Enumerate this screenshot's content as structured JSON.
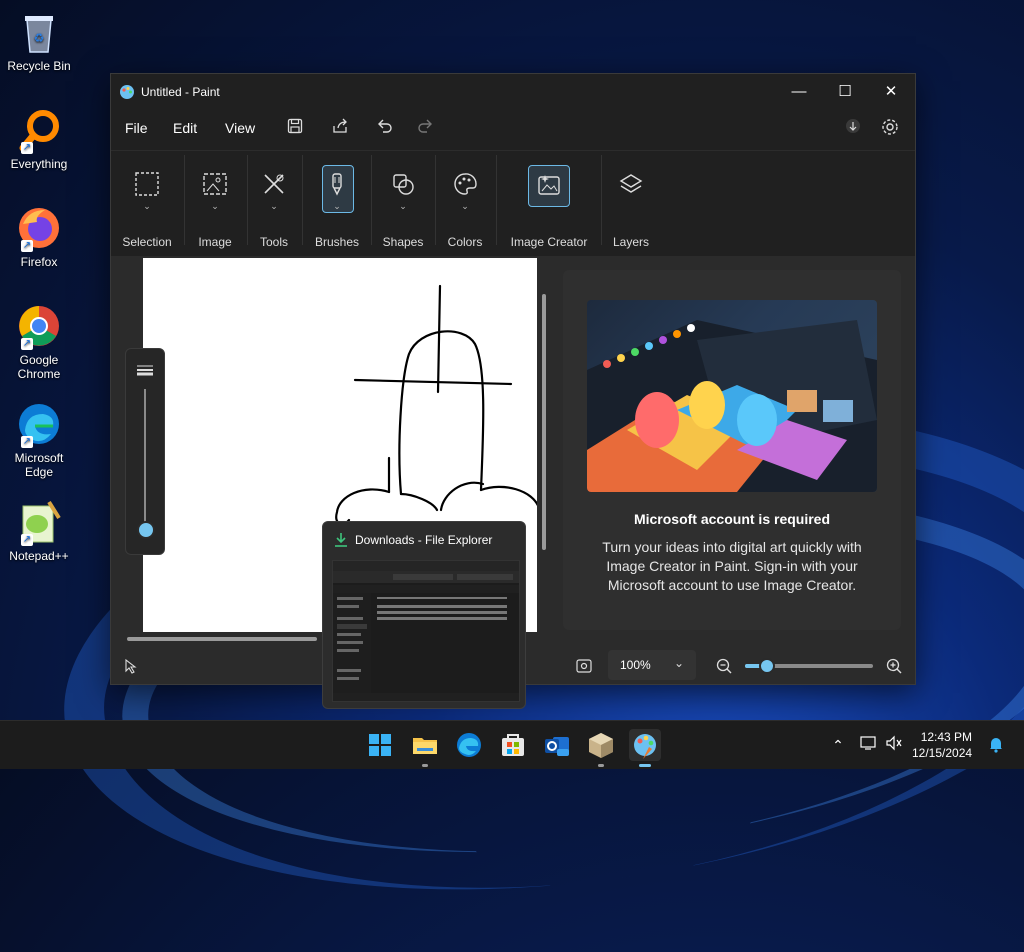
{
  "desktop": {
    "icons": [
      {
        "label": "Recycle Bin"
      },
      {
        "label": "Everything"
      },
      {
        "label": "Firefox"
      },
      {
        "label": "Google Chrome"
      },
      {
        "label": "Microsoft Edge"
      },
      {
        "label": "Notepad++"
      }
    ]
  },
  "window": {
    "title": "Untitled - Paint",
    "controls": {
      "minimize": "—",
      "maximize": "☐",
      "close": "✕"
    }
  },
  "menu": {
    "file": "File",
    "edit": "Edit",
    "view": "View"
  },
  "ribbon": {
    "groups": [
      {
        "label": "Selection"
      },
      {
        "label": "Image"
      },
      {
        "label": "Tools"
      },
      {
        "label": "Brushes"
      },
      {
        "label": "Shapes"
      },
      {
        "label": "Colors"
      },
      {
        "label": "Image Creator"
      },
      {
        "label": "Layers"
      }
    ]
  },
  "image_creator_panel": {
    "title": "Microsoft account is required",
    "body": "Turn your ideas into digital art quickly with Image Creator in Paint. Sign-in with your Microsoft account to use Image Creator."
  },
  "status": {
    "zoom": "100%",
    "zoom_level_percent": 17
  },
  "thumbnail": {
    "title": "Downloads - File Explorer"
  },
  "taskbar": {
    "clock_time": "12:43 PM",
    "clock_date": "12/15/2024"
  }
}
